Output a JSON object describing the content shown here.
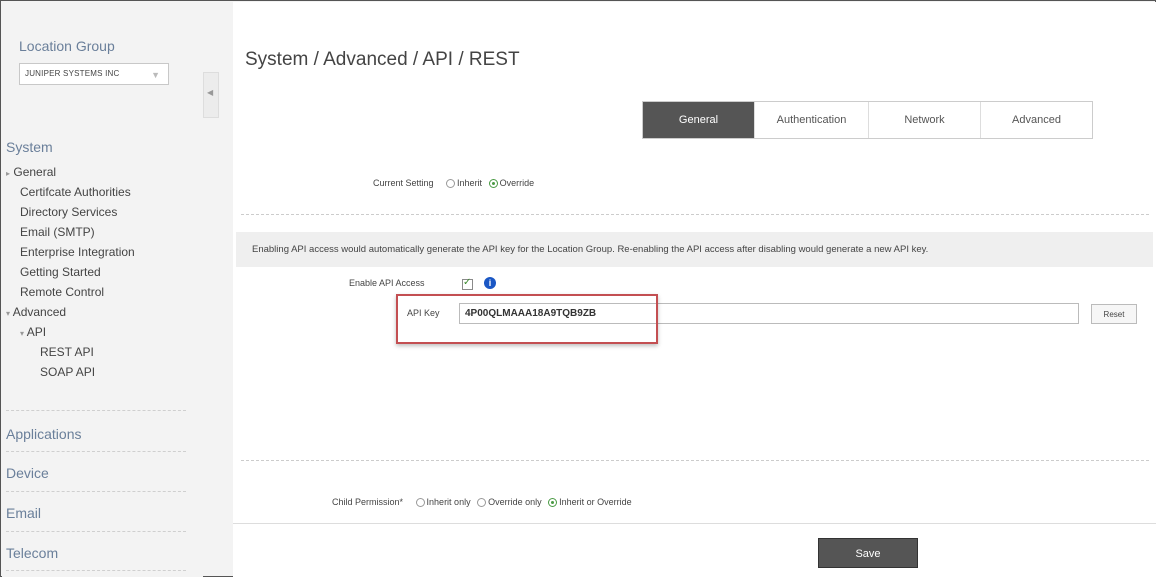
{
  "sidebar": {
    "location_group_title": "Location Group",
    "location_group_value": "JUNIPER SYSTEMS INC",
    "system_title": "System",
    "items": [
      {
        "label": "General",
        "arrow": "▸"
      },
      {
        "label": "Certifcate Authorities"
      },
      {
        "label": "Directory Services"
      },
      {
        "label": "Email (SMTP)"
      },
      {
        "label": "Enterprise Integration"
      },
      {
        "label": "Getting Started"
      },
      {
        "label": "Remote Control"
      },
      {
        "label": "Advanced",
        "arrow": "▾"
      },
      {
        "label": "API",
        "arrow": "▾"
      },
      {
        "label": "REST API"
      },
      {
        "label": "SOAP API"
      }
    ],
    "sections": [
      "Applications",
      "Device",
      "Email",
      "Telecom"
    ]
  },
  "main": {
    "breadcrumb": "System / Advanced / API / REST",
    "tabs": [
      "General",
      "Authentication",
      "Network",
      "Advanced"
    ],
    "active_tab": "General",
    "current_setting": {
      "label": "Current Setting",
      "options": [
        "Inherit",
        "Override"
      ],
      "selected": "Override"
    },
    "notice": "Enabling API access would automatically generate the API key for the Location Group. Re-enabling the API access after disabling would generate a new API key.",
    "enable_api_access_label": "Enable API Access",
    "enable_api_access_checked": true,
    "api_key_label": "API Key",
    "api_key_value": "4P00QLMAAA18A9TQB9ZB",
    "reset_label": "Reset",
    "child_permission": {
      "label": "Child Permission*",
      "options": [
        "Inherit only",
        "Override only",
        "Inherit or Override"
      ],
      "selected": "Inherit or Override"
    },
    "save_label": "Save"
  },
  "colors": {
    "active_tab_bg": "#555555",
    "highlight_border": "#c34f52",
    "info_icon": "#1a57c4",
    "selected_radio": "#4a9a44"
  }
}
